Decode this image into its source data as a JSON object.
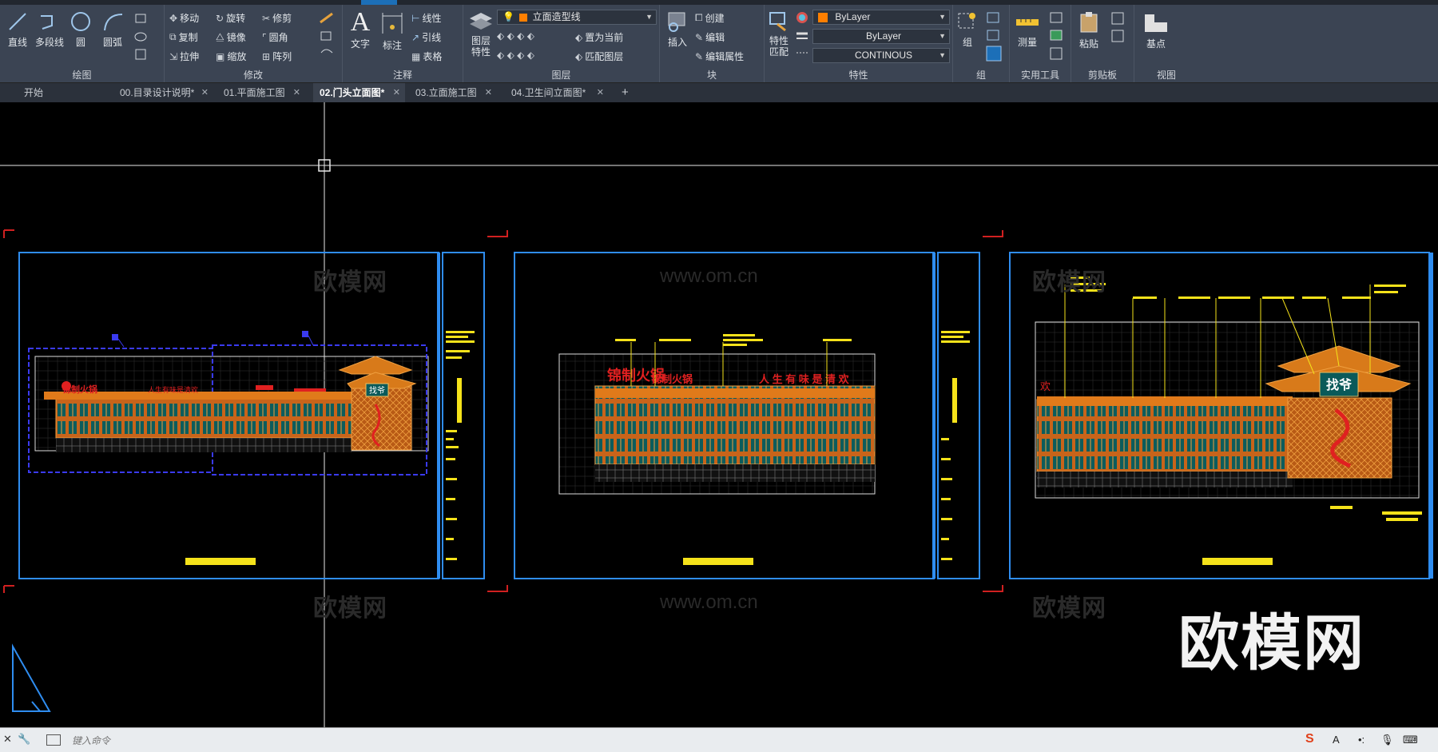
{
  "ribbon": {
    "panels": {
      "draw": "绘图",
      "modify": "修改",
      "annotate": "注释",
      "layers": "图层",
      "block": "块",
      "properties": "特性",
      "group": "组",
      "utilities": "实用工具",
      "clipboard": "剪贴板",
      "view": "视图"
    },
    "draw": {
      "line": "直线",
      "polyline": "多段线",
      "circle": "圆",
      "arc": "圆弧"
    },
    "modify": {
      "move": "移动",
      "rotate": "旋转",
      "trim": "修剪",
      "copy": "复制",
      "mirror": "镜像",
      "fillet": "圆角",
      "stretch": "拉伸",
      "scale": "缩放",
      "array": "阵列"
    },
    "annotate": {
      "text": "文字",
      "dimension": "标注",
      "linear": "线性",
      "leader": "引线",
      "table": "表格"
    },
    "layers": {
      "layer_props": "图层特性",
      "current_layer": "立面造型线",
      "make_current": "置为当前",
      "match_layer": "匹配图层"
    },
    "block": {
      "insert": "插入",
      "create": "创建",
      "edit": "编辑",
      "edit_attr": "编辑属性"
    },
    "properties": {
      "match": "特性匹配",
      "color": "ByLayer",
      "color_hex": "#ff7f00",
      "lineweight": "ByLayer",
      "linetype": "CONTINOUS"
    },
    "group": {
      "group": "组"
    },
    "utilities": {
      "measure": "测量"
    },
    "clipboard": {
      "paste": "粘贴"
    },
    "view": {
      "base": "基点"
    }
  },
  "tabs": [
    {
      "label": "开始",
      "closable": false
    },
    {
      "label": "00.目录设计说明*",
      "closable": true
    },
    {
      "label": "01.平面施工图",
      "closable": true
    },
    {
      "label": "02.门头立面图*",
      "closable": true,
      "active": true
    },
    {
      "label": "03.立面施工图",
      "closable": true
    },
    {
      "label": "04.卫生间立面图*",
      "closable": true
    }
  ],
  "tab_add": "+",
  "drawing": {
    "sign_left_brand": "锦制火锅",
    "sign_left_slogan": "人生有味是清欢",
    "sign_mid_brand": "锦制火锅",
    "sign_mid_slogan": "人 生 有 味 是 清 欢",
    "sign_right_slogan": "欢",
    "plaque_text": "找爷"
  },
  "watermarks": {
    "brand": "欧模网",
    "url": "www.om.cn"
  },
  "command": {
    "placeholder": "键入命令"
  }
}
